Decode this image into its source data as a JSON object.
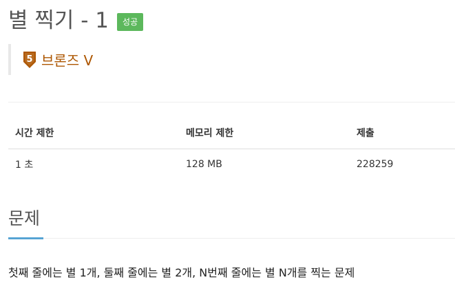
{
  "problem": {
    "title": "별 찍기 - 1",
    "result_badge": "성공",
    "tier": {
      "number": "5",
      "label": "브론즈 V",
      "color": "#ad5600",
      "icon": "bronze-tier-shield-icon"
    }
  },
  "info_table": {
    "headers": [
      "시간 제한",
      "메모리 제한",
      "제출"
    ],
    "rows": [
      [
        "1 초",
        "128 MB",
        "228259"
      ]
    ]
  },
  "sections": {
    "description": {
      "title": "문제",
      "body": "첫째 줄에는 별 1개, 둘째 줄에는 별 2개, N번째 줄에는 별 N개를 찍는 문제"
    }
  },
  "colors": {
    "success": "#5cb85c",
    "accent": "#0076c0"
  }
}
